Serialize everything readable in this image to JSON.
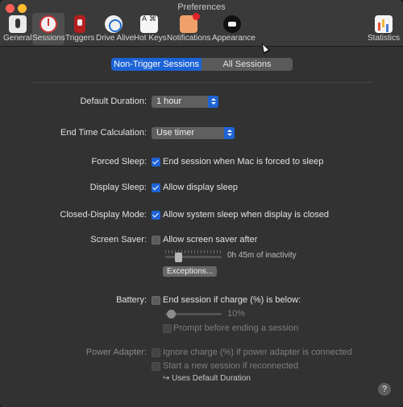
{
  "window": {
    "title": "Preferences"
  },
  "toolbar": {
    "items": [
      {
        "label": "General",
        "icon": "general-icon"
      },
      {
        "label": "Sessions",
        "icon": "sessions-icon"
      },
      {
        "label": "Triggers",
        "icon": "triggers-icon"
      },
      {
        "label": "Drive Alive",
        "icon": "drive-alive-icon"
      },
      {
        "label": "Hot Keys",
        "icon": "hot-keys-icon",
        "glyph": "A ⌘"
      },
      {
        "label": "Notifications",
        "icon": "notifications-icon"
      },
      {
        "label": "Appearance",
        "icon": "appearance-icon"
      },
      {
        "label": "Statistics",
        "icon": "statistics-icon"
      }
    ],
    "selected": "Sessions"
  },
  "segment": {
    "active": "Non-Trigger Sessions",
    "inactive": "All Sessions"
  },
  "default_duration": {
    "label": "Default Duration:",
    "value": "1 hour"
  },
  "end_time_calc": {
    "label": "End Time Calculation:",
    "value": "Use timer"
  },
  "forced_sleep": {
    "label": "Forced Sleep:",
    "option": "End session when Mac is forced to sleep",
    "checked": true
  },
  "display_sleep": {
    "label": "Display Sleep:",
    "option": "Allow display sleep",
    "checked": true
  },
  "closed_display": {
    "label": "Closed-Display Mode:",
    "option": "Allow system sleep when display is closed",
    "checked": true
  },
  "screen_saver": {
    "label": "Screen Saver:",
    "option": "Allow screen saver after",
    "checked": false,
    "slider_text": "0h 45m of inactivity",
    "exceptions_button": "Exceptions..."
  },
  "battery": {
    "label": "Battery:",
    "option": "End session if charge (%) is below:",
    "checked": false,
    "slider_text": "10%",
    "prompt_option": "Prompt before ending a session"
  },
  "power_adapter": {
    "label": "Power Adapter:",
    "option": "Ignore charge (%) if power adapter is connected",
    "restart_option": "Start a new session if reconnected",
    "uses_default": "↪ Uses Default Duration"
  },
  "help": "?",
  "colors": {
    "accent": "#1f63d5",
    "window_bg": "#323232",
    "close": "#fe5f57",
    "minimize": "#febc2e"
  }
}
